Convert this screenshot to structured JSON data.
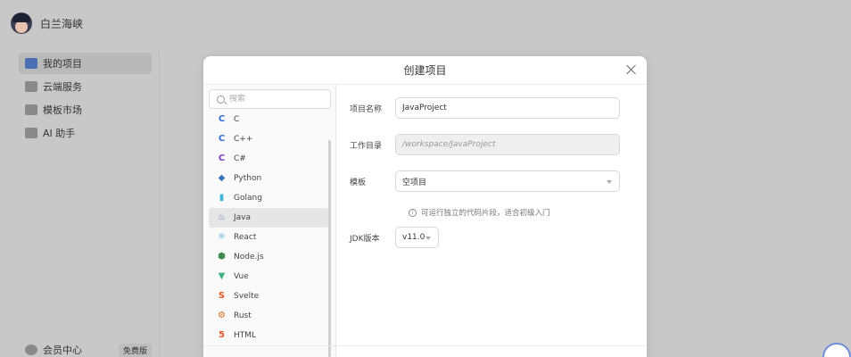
{
  "app": {
    "user_name": "白兰海峡"
  },
  "sidebar": {
    "items": [
      {
        "label": "我的项目",
        "icon": "folder-icon",
        "active": true
      },
      {
        "label": "云端服务",
        "icon": "cloud-icon",
        "active": false
      },
      {
        "label": "模板市场",
        "icon": "store-icon",
        "active": false
      },
      {
        "label": "AI 助手",
        "icon": "robot-icon",
        "active": false
      }
    ],
    "bottom": {
      "label": "会员中心",
      "badge": "免费版",
      "icon": "member-icon"
    }
  },
  "modal": {
    "title": "创建项目",
    "search_placeholder": "搜索",
    "languages": [
      {
        "label": "C",
        "icon": "c-icon",
        "color": "#2f6fd6",
        "glyph": "C"
      },
      {
        "label": "C++",
        "icon": "cpp-icon",
        "color": "#2f6fd6",
        "glyph": "C"
      },
      {
        "label": "C#",
        "icon": "csharp-icon",
        "color": "#7b3fc4",
        "glyph": "C"
      },
      {
        "label": "Python",
        "icon": "python-icon",
        "color": "#3a74b8",
        "glyph": "◆"
      },
      {
        "label": "Golang",
        "icon": "golang-icon",
        "color": "#3cb5d8",
        "glyph": "▮"
      },
      {
        "label": "Java",
        "icon": "java-icon",
        "color": "#5a7fb0",
        "glyph": "♨"
      },
      {
        "label": "React",
        "icon": "react-icon",
        "color": "#2aa6c9",
        "glyph": "⚛"
      },
      {
        "label": "Node.js",
        "icon": "nodejs-icon",
        "color": "#3d8a4a",
        "glyph": "⬢"
      },
      {
        "label": "Vue",
        "icon": "vue-icon",
        "color": "#3fb37f",
        "glyph": "▼"
      },
      {
        "label": "Svelte",
        "icon": "svelte-icon",
        "color": "#e8541c",
        "glyph": "S"
      },
      {
        "label": "Rust",
        "icon": "rust-icon",
        "color": "#d86a1c",
        "glyph": "⚙"
      },
      {
        "label": "HTML",
        "icon": "html-icon",
        "color": "#e4572e",
        "glyph": "5"
      }
    ],
    "selected_language": "Java",
    "form": {
      "name_label": "项目名称",
      "name_value": "JavaProject",
      "dir_label": "工作目录",
      "dir_value": "/workspace/JavaProject",
      "template_label": "模板",
      "template_value": "空项目",
      "template_hint": "可运行独立的代码片段，适合初级入门",
      "jdk_label": "JDK版本",
      "jdk_value": "v11.0"
    }
  }
}
